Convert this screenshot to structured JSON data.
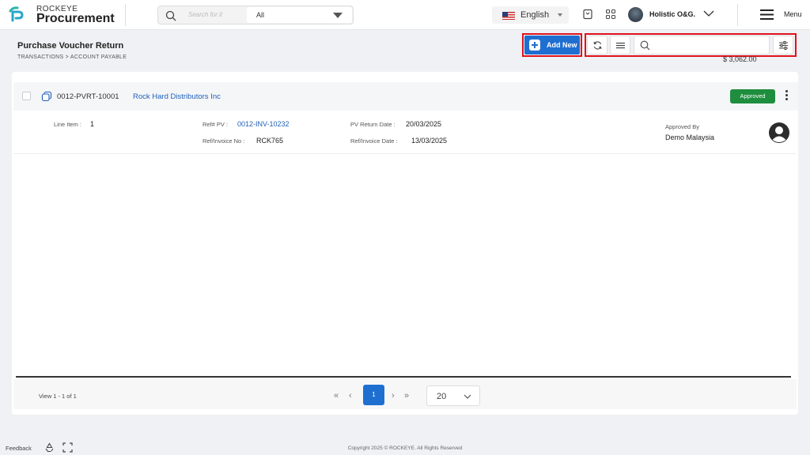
{
  "header": {
    "brand_top": "ROCKEYE",
    "brand_main": "Procurement",
    "search_placeholder": "Search for it",
    "search_scope": "All",
    "language": "English",
    "user_name": "Holistic O&G.",
    "menu_label": "Menu"
  },
  "page": {
    "title": "Purchase Voucher Return",
    "breadcrumb": "TRANSACTIONS >  ACCOUNT PAYABLE",
    "add_new_label": "Add New",
    "total": "$ 3,062.00"
  },
  "record": {
    "voucher_id": "0012-PVRT-10001",
    "supplier": "Rock Hard Distributors Inc",
    "status": "Approved",
    "line_item_label": "Line Item :",
    "line_item_value": "1",
    "ref_pv_label": "Ref# PV :",
    "ref_pv_value": "0012-INV-10232",
    "ref_invoice_label": "Ref/Invoice No :",
    "ref_invoice_value": "RCK765",
    "return_date_label": "PV Return Date :",
    "return_date_value": "20/03/2025",
    "invoice_date_label": "Ref/Invoice Date :",
    "invoice_date_value": "13/03/2025",
    "approved_by_label": "Approved By",
    "approved_by_value": "Demo Malaysia"
  },
  "pagination": {
    "view_count": "View 1 - 1 of 1",
    "current_page": "1",
    "page_size": "20"
  },
  "footer": {
    "feedback": "Feedback",
    "copyright": "Copyright 2025 © ROCKEYE. All Rights Reserved"
  },
  "colors": {
    "accent": "#1f6fd1",
    "approved": "#1e8e3e",
    "highlight_frame": "#e0121b",
    "link": "#1f5fb8"
  }
}
